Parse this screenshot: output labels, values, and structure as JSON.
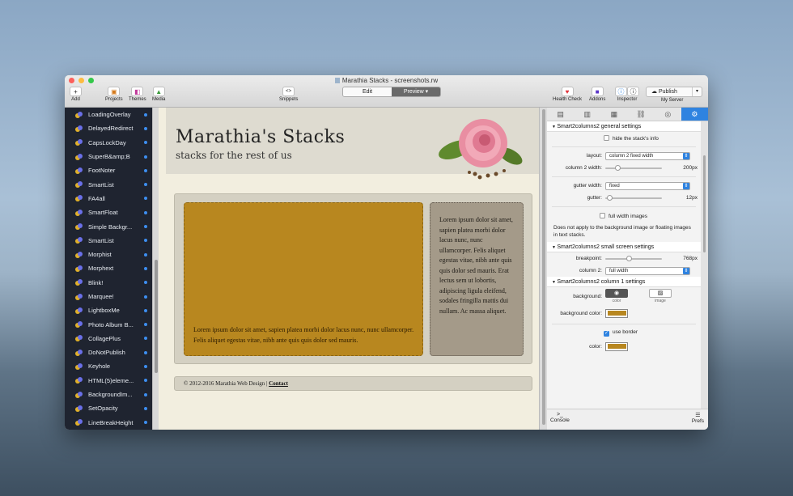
{
  "window": {
    "title": "Marathia Stacks - screenshots.rw",
    "colors": {
      "close": "#fc605c",
      "min": "#fdbc40",
      "max": "#34c84a"
    }
  },
  "toolbar": {
    "add": "Add",
    "projects": "Projects",
    "themes": "Themes",
    "media": "Media",
    "snippets": "Snippets",
    "edit": "Edit",
    "preview": "Preview",
    "health_check": "Health Check",
    "addons": "Addons",
    "inspector": "Inspector",
    "publish": "Publish",
    "my_server": "My Server"
  },
  "sidebar": {
    "items": [
      "LoadingOverlay",
      "DelayedRedirect",
      "CapsLockDay",
      "SuperB&amp;B",
      "FootNoter",
      "SmartList",
      "FA4all",
      "SmartFloat",
      "Simple Backgr...",
      "SmartList",
      "Morphist",
      "Morphext",
      "Blink!",
      "Marquee!",
      "LightboxMe",
      "Photo Album B...",
      "CollagePlus",
      "DoNotPublish",
      "Keyhole",
      "HTML(5)eleme...",
      "BackgroundIm...",
      "SetOpacity",
      "LineBreakHeight"
    ]
  },
  "site": {
    "title": "Marathia's Stacks",
    "subtitle": "stacks for the rest of us",
    "col1_text": "Lorem ipsum dolor sit amet, sapien platea morbi dolor lacus nunc, nunc ullamcorper. Felis aliquet egestas vitae, nibh ante quis quis dolor sed mauris.",
    "col2_text": "Lorem ipsum dolor sit amet, sapien platea morbi dolor lacus nunc, nunc ullamcorper. Felis aliquet egestas vitae, nibh ante quis quis dolor sed mauris. Erat lectus sem ut lobortis, adipiscing ligula eleifend, sodales fringilla mattis dui nullam. Ac massa aliquet.",
    "footer_copyright": "© 2012-2016 Marathia Web Design |",
    "footer_link": "Contact",
    "colors": {
      "col1": "#b8871f",
      "col2": "#a49a89"
    }
  },
  "inspector": {
    "sec_general": "Smart2columns2 general settings",
    "hide_info": "hide the stack's info",
    "layout_label": "layout:",
    "layout_value": "column 2 fixed width",
    "col2_width_label": "column 2 width:",
    "col2_width_value": "200px",
    "gutter_width_label": "gutter width:",
    "gutter_width_value": "fixed",
    "gutter_label": "gutter:",
    "gutter_value": "12px",
    "full_width_images": "full width images",
    "note": "Does not apply to the background image or floating images in text stacks.",
    "sec_small": "Smart2columns2 small screen settings",
    "breakpoint_label": "breakpoint:",
    "breakpoint_value": "768px",
    "column2_label": "column 2:",
    "column2_value": "full width",
    "sec_col1": "Smart2columns2 column 1 settings",
    "background_label": "background:",
    "color_caption": "color",
    "image_caption": "image",
    "bg_color_label": "background color:",
    "use_border": "use border",
    "color_label": "color:",
    "console": "Console",
    "prefs": "Prefs"
  }
}
